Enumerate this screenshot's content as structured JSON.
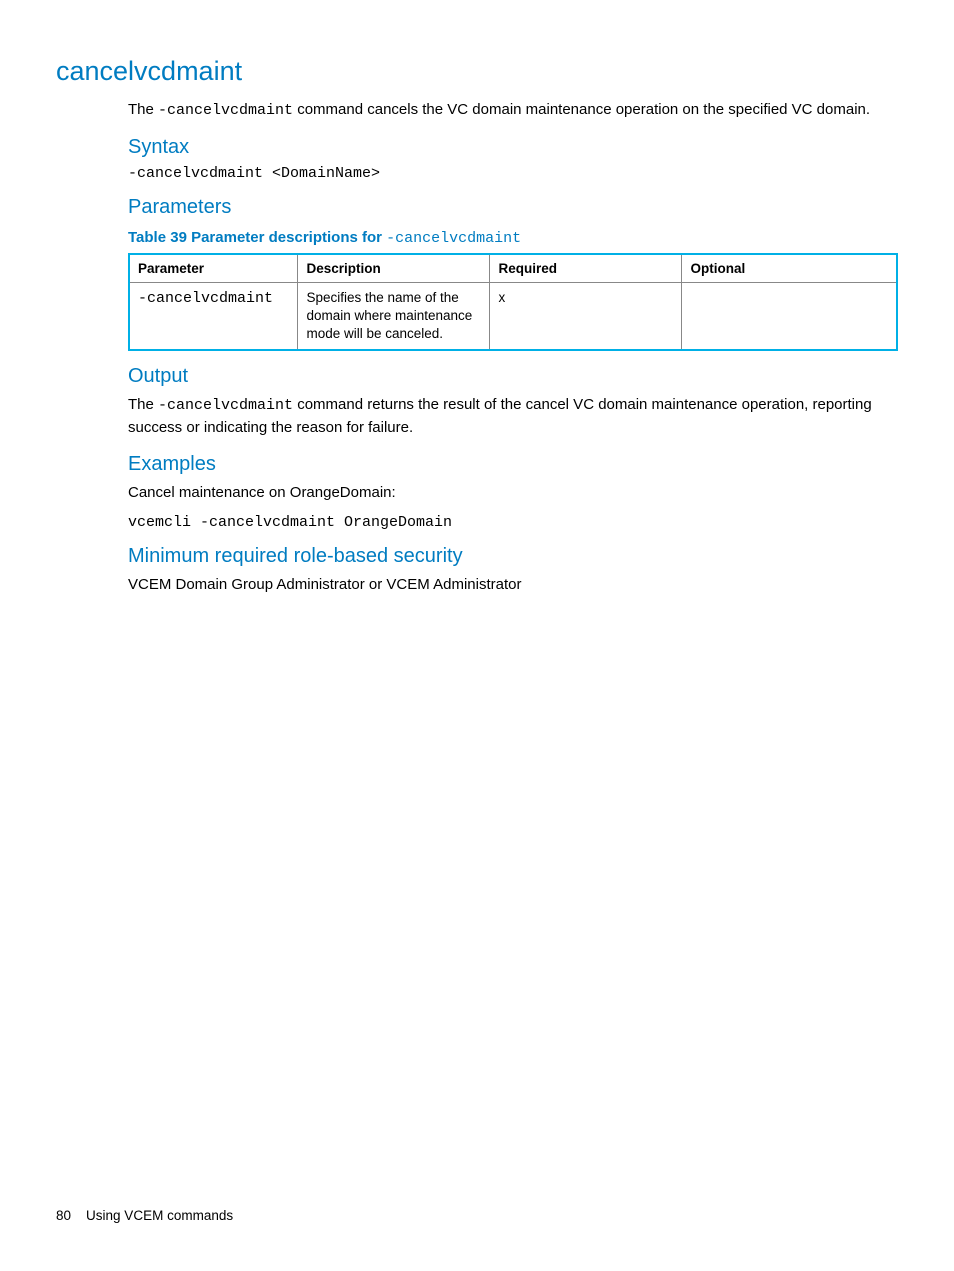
{
  "title": "cancelvcdmaint",
  "intro": {
    "prefix": "The ",
    "code": "-cancelvcdmaint",
    "suffix": " command cancels the VC domain maintenance operation on the specified VC domain."
  },
  "syntax": {
    "heading": "Syntax",
    "code": "-cancelvcdmaint <DomainName>"
  },
  "parameters": {
    "heading": "Parameters",
    "caption_prefix": "Table 39 Parameter descriptions for ",
    "caption_code": "-cancelvcdmaint",
    "headers": {
      "parameter": "Parameter",
      "description": "Description",
      "required": "Required",
      "optional": "Optional"
    },
    "rows": [
      {
        "parameter": "-cancelvcdmaint",
        "description": "Specifies the name of the domain where maintenance mode will be canceled.",
        "required": "x",
        "optional": ""
      }
    ]
  },
  "output": {
    "heading": "Output",
    "text_prefix": "The ",
    "text_code": "-cancelvcdmaint",
    "text_suffix": " command returns the result of the cancel VC domain maintenance operation, reporting success or indicating the reason for failure."
  },
  "examples": {
    "heading": "Examples",
    "text": "Cancel maintenance on OrangeDomain:",
    "code": "vcemcli -cancelvcdmaint OrangeDomain"
  },
  "security": {
    "heading": "Minimum required role-based security",
    "text": "VCEM Domain Group Administrator or VCEM Administrator"
  },
  "footer": {
    "page": "80",
    "label": "Using VCEM commands"
  }
}
